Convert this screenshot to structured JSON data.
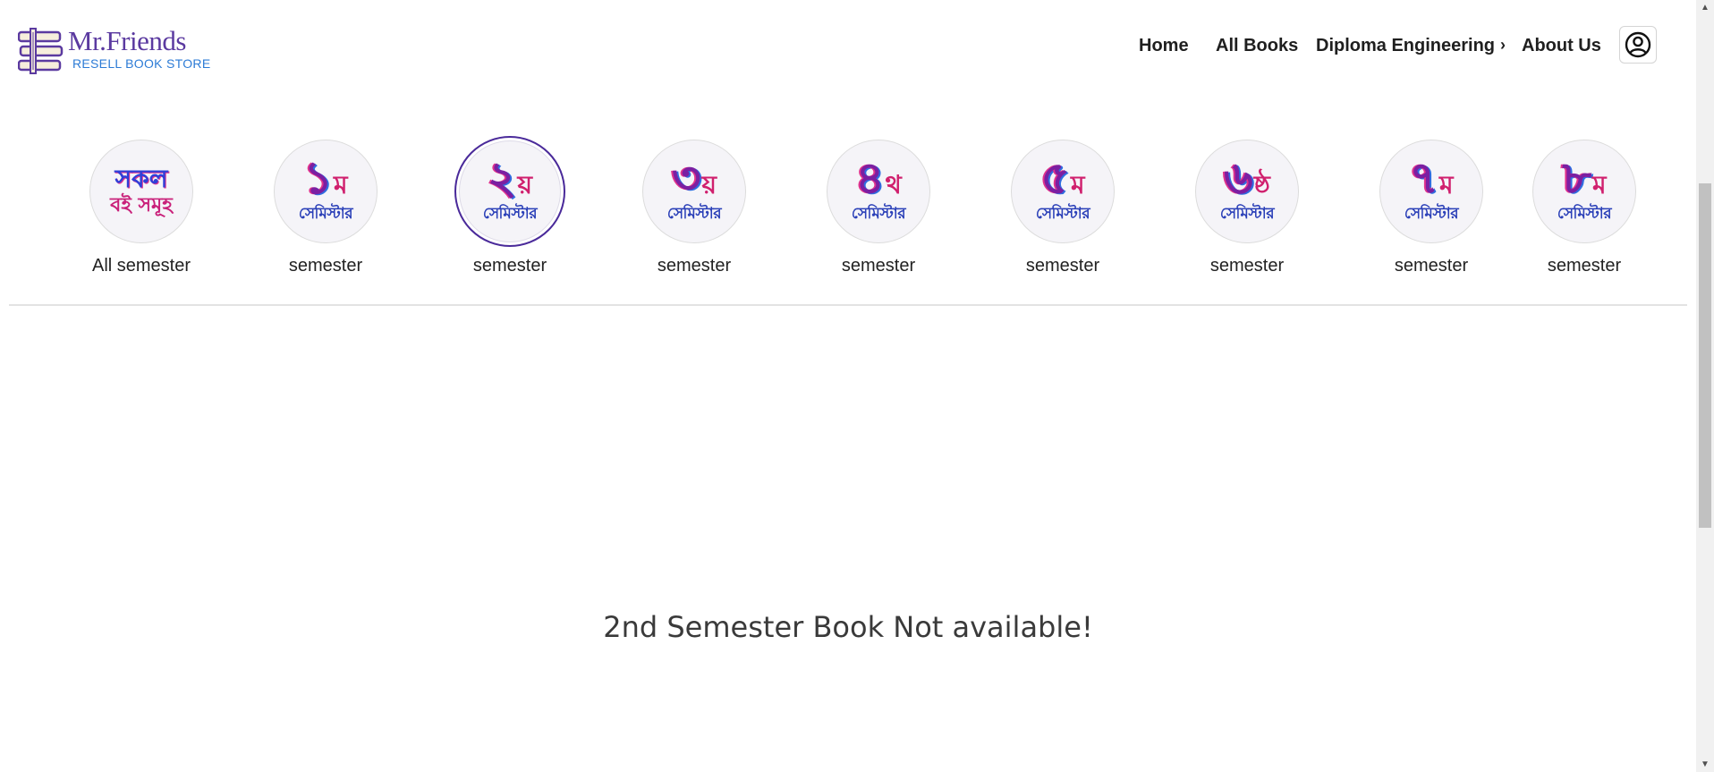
{
  "brand": {
    "title": "Mr.Friends",
    "subtitle": "RESELL BOOK STORE",
    "icon_text": "BOOKS"
  },
  "nav": {
    "home": "Home",
    "all_books": "All Books",
    "diploma": "Diploma Engineering",
    "about": "About Us"
  },
  "semesters": [
    {
      "top": "সকল",
      "bottom": "বই সমূহ",
      "label": "All semester"
    },
    {
      "num": "১",
      "suffix": "ম",
      "word": "সেমিস্টার",
      "label": "semester"
    },
    {
      "num": "২",
      "suffix": "য়",
      "word": "সেমিস্টার",
      "label": "semester",
      "active": true
    },
    {
      "num": "৩",
      "suffix": "য়",
      "word": "সেমিস্টার",
      "label": "semester"
    },
    {
      "num": "৪",
      "suffix": "থ",
      "word": "সেমিস্টার",
      "label": "semester"
    },
    {
      "num": "৫",
      "suffix": "ম",
      "word": "সেমিস্টার",
      "label": "semester"
    },
    {
      "num": "৬",
      "suffix": "ষ্ঠ",
      "word": "সেমিস্টার",
      "label": "semester"
    },
    {
      "num": "৭",
      "suffix": "ম",
      "word": "সেমিস্টার",
      "label": "semester"
    },
    {
      "num": "৮",
      "suffix": "ম",
      "word": "সেমিস্টার",
      "label": "semester"
    }
  ],
  "message": "2nd Semester Book Not available!",
  "colors": {
    "brand_purple": "#5b3aa0",
    "brand_blue": "#2c7bd6",
    "active_ring": "#4a2a9a"
  }
}
